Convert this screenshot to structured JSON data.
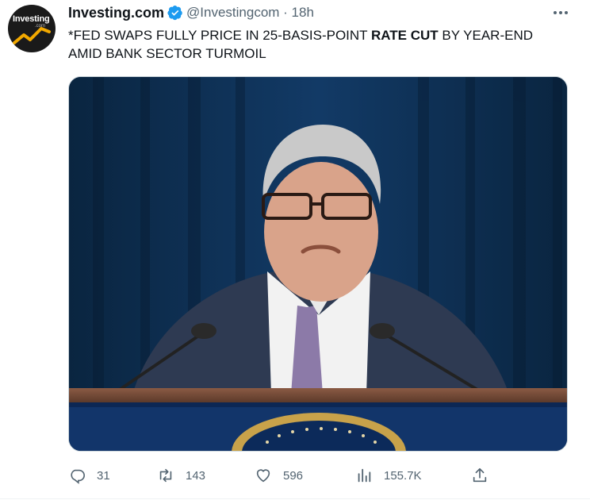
{
  "account": {
    "display_name": "Investing.com",
    "handle_time": "@Investingcom · 18h",
    "avatar_logo": "Investing",
    "avatar_sub": ".com"
  },
  "tweet": {
    "text_before": "*FED SWAPS FULLY PRICE IN 25-BASIS-POINT ",
    "text_bold": "RATE CUT",
    "text_after": " BY YEAR-END\nAMID BANK SECTOR TURMOIL"
  },
  "actions": {
    "reply_count": "31",
    "retweet_count": "143",
    "like_count": "596",
    "views_count": "155.7K"
  },
  "colors": {
    "verified": "#1d9bf0",
    "secondary_text": "#536471",
    "curtain": "#0b2a4a"
  },
  "icons": {
    "verified": "verified-badge-icon",
    "more": "more-options-icon",
    "reply": "reply-icon",
    "retweet": "retweet-icon",
    "like": "heart-icon",
    "views": "views-icon",
    "share": "share-icon"
  }
}
